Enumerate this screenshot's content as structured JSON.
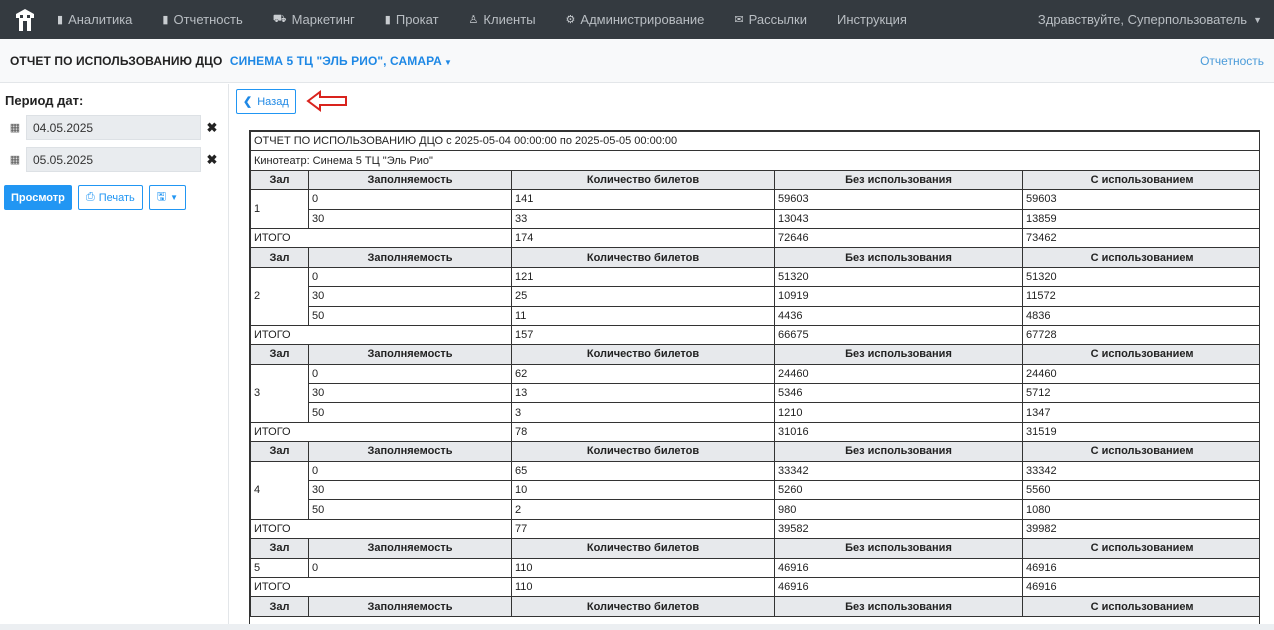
{
  "nav": {
    "items": [
      {
        "icon": "bar-chart-icon",
        "glyph": "▮",
        "label": "Аналитика"
      },
      {
        "icon": "bar-chart-icon",
        "glyph": "▮",
        "label": "Отчетность"
      },
      {
        "icon": "cart-icon",
        "glyph": "⛟",
        "label": "Маркетинг"
      },
      {
        "icon": "film-icon",
        "glyph": "▮",
        "label": "Прокат"
      },
      {
        "icon": "user-icon",
        "glyph": "♙",
        "label": "Клиенты"
      },
      {
        "icon": "cogs-icon",
        "glyph": "⚙",
        "label": "Администрирование"
      },
      {
        "icon": "envelope-icon",
        "glyph": "✉",
        "label": "Рассылки"
      },
      {
        "icon": "",
        "glyph": "",
        "label": "Инструкция"
      }
    ],
    "greeting": "Здравствуйте, Суперпользователь"
  },
  "header": {
    "title": "ОТЧЕТ ПО ИСПОЛЬЗОВАНИЮ ДЦО",
    "cinema": "СИНЕМА 5 ТЦ \"ЭЛЬ РИО\", САМАРА",
    "right_link": "Отчетность"
  },
  "sidebar": {
    "period_label": "Период дат:",
    "date_from": "04.05.2025",
    "date_to": "05.05.2025",
    "view_button": "Просмотр",
    "print_button": "Печать"
  },
  "content": {
    "back_button": "Назад"
  },
  "report": {
    "title": "ОТЧЕТ ПО ИСПОЛЬЗОВАНИЮ ДЦО с 2025-05-04 00:00:00 по 2025-05-05 00:00:00",
    "cinema": "Кинотеатр: Синема 5 ТЦ \"Эль Рио\"",
    "columns": [
      "Зал",
      "Заполняемость",
      "Количество билетов",
      "Без использования",
      "С использованием"
    ],
    "total_label": "ИТОГО",
    "halls": [
      {
        "hall": "1",
        "rows": [
          [
            "0",
            "141",
            "59603",
            "59603"
          ],
          [
            "30",
            "33",
            "13043",
            "13859"
          ]
        ],
        "total": [
          "174",
          "72646",
          "73462"
        ]
      },
      {
        "hall": "2",
        "rows": [
          [
            "0",
            "121",
            "51320",
            "51320"
          ],
          [
            "30",
            "25",
            "10919",
            "11572"
          ],
          [
            "50",
            "11",
            "4436",
            "4836"
          ]
        ],
        "total": [
          "157",
          "66675",
          "67728"
        ]
      },
      {
        "hall": "3",
        "rows": [
          [
            "0",
            "62",
            "24460",
            "24460"
          ],
          [
            "30",
            "13",
            "5346",
            "5712"
          ],
          [
            "50",
            "3",
            "1210",
            "1347"
          ]
        ],
        "total": [
          "78",
          "31016",
          "31519"
        ]
      },
      {
        "hall": "4",
        "rows": [
          [
            "0",
            "65",
            "33342",
            "33342"
          ],
          [
            "30",
            "10",
            "5260",
            "5560"
          ],
          [
            "50",
            "2",
            "980",
            "1080"
          ]
        ],
        "total": [
          "77",
          "39582",
          "39982"
        ]
      },
      {
        "hall": "5",
        "rows": [
          [
            "0",
            "110",
            "46916",
            "46916"
          ]
        ],
        "total": [
          "110",
          "46916",
          "46916"
        ]
      }
    ]
  },
  "colors": {
    "nav_bg": "#343a40",
    "accent": "#2196f3",
    "arrow": "#d9231d"
  }
}
